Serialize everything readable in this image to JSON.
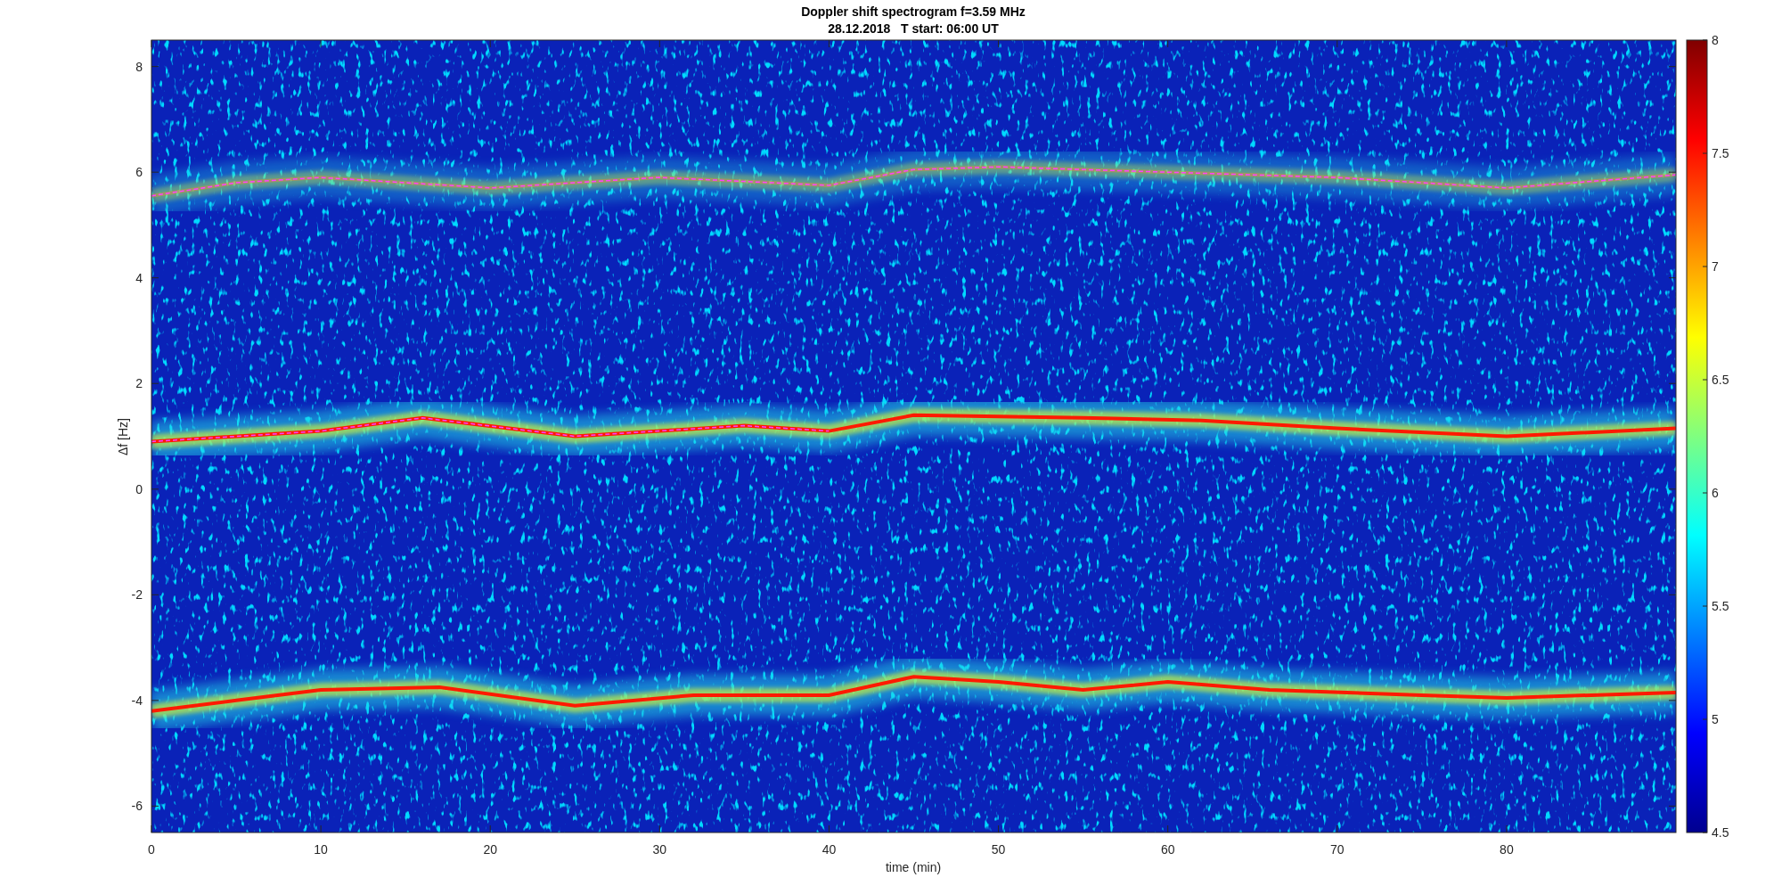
{
  "figure": {
    "title": "Doppler shift spectrogram f=3.59 MHz",
    "subtitle": "28.12.2018   T start: 06:00 UT"
  },
  "axes": {
    "xlabel": "time (min)",
    "ylabel": "Δf [Hz]",
    "xticks": [
      "0",
      "10",
      "20",
      "30",
      "40",
      "50",
      "60",
      "70",
      "80"
    ],
    "yticks": [
      "8",
      "6",
      "4",
      "2",
      "0",
      "-2",
      "-4",
      "-6"
    ]
  },
  "colorbar": {
    "ticks": [
      "8",
      "7.5",
      "7",
      "6.5",
      "6",
      "5.5",
      "5",
      "4.5"
    ]
  }
}
